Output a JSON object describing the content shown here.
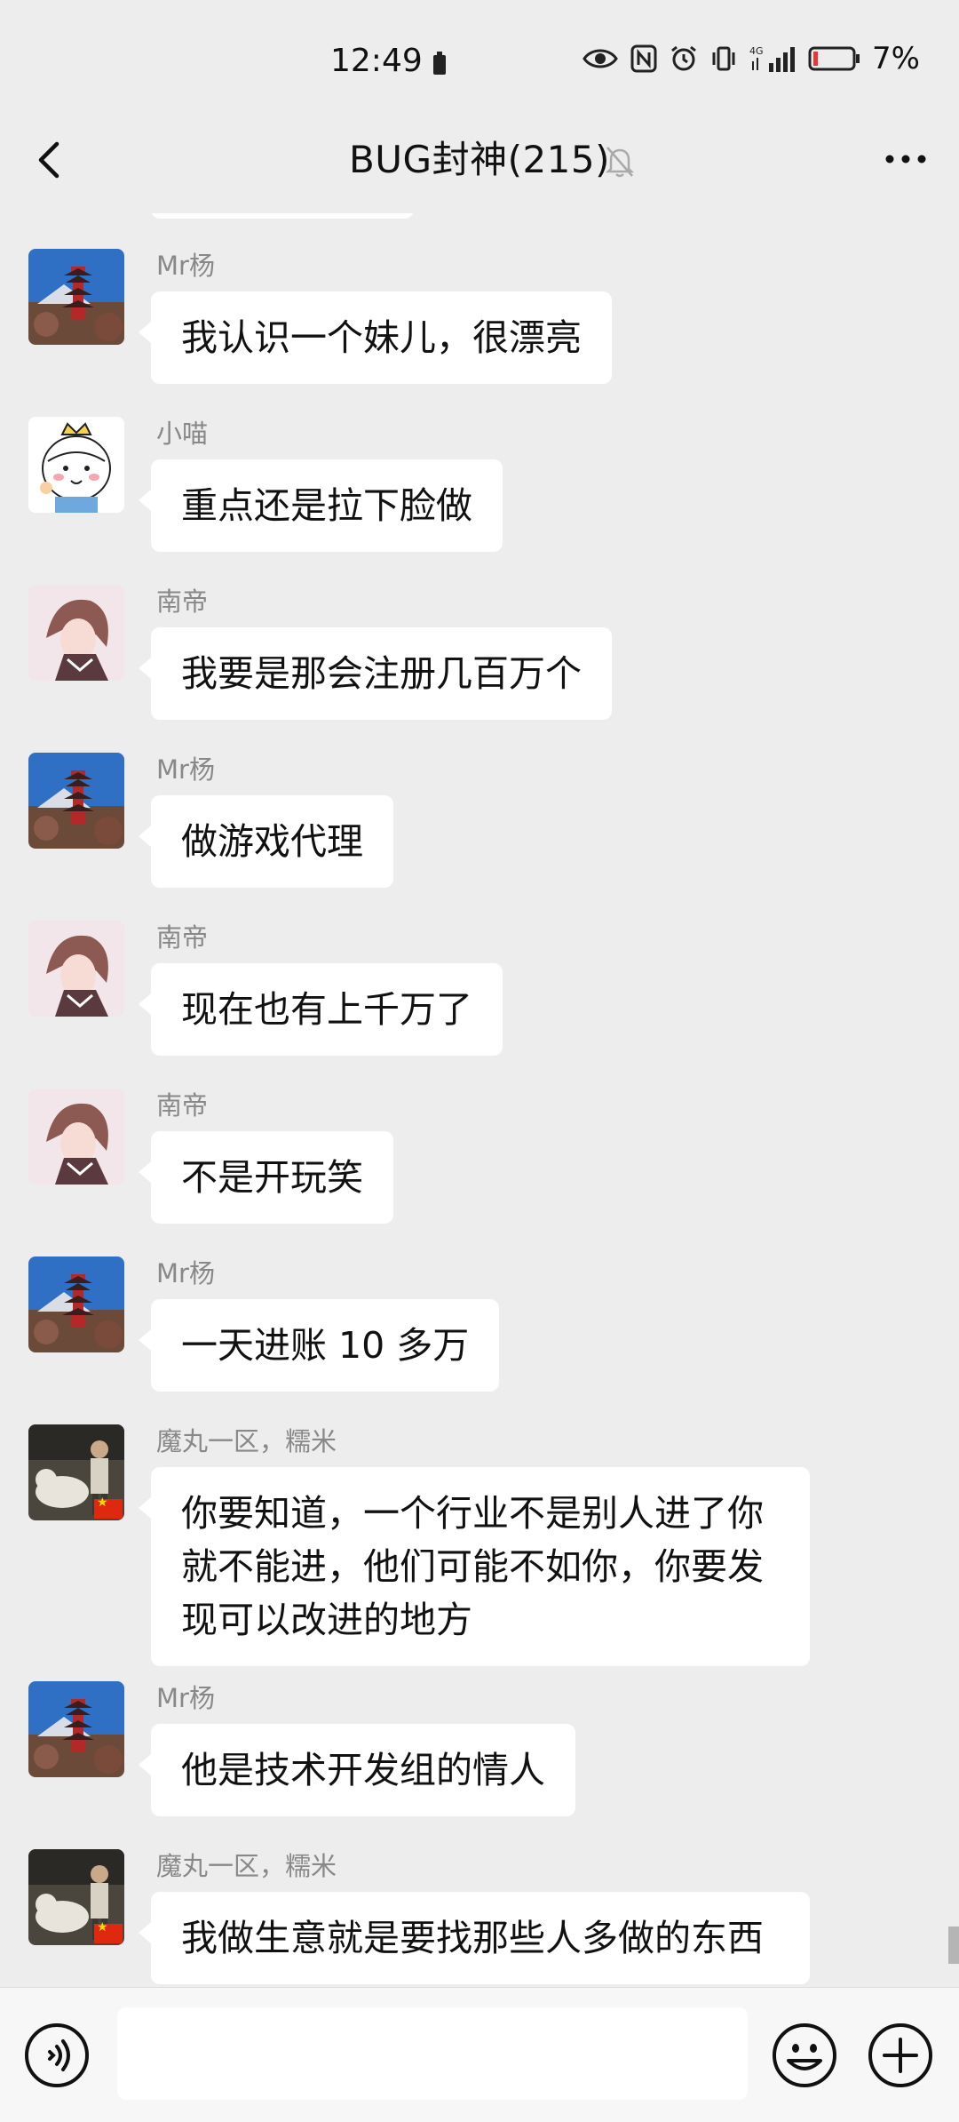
{
  "status_bar": {
    "time": "12:49",
    "battery_percent": "7%",
    "network": "4G"
  },
  "header": {
    "title": "BUG封神(215)"
  },
  "messages": [
    {
      "sender": "Mr杨",
      "text": "我认识一个妹儿，很漂亮",
      "avatar": "pagoda-avatar"
    },
    {
      "sender": "小喵",
      "text": "重点还是拉下脸做",
      "avatar": "cartoon-prince-avatar"
    },
    {
      "sender": "南帝",
      "text": "我要是那会注册几百万个",
      "avatar": "anime-boy-avatar"
    },
    {
      "sender": "Mr杨",
      "text": "做游戏代理",
      "avatar": "pagoda-avatar"
    },
    {
      "sender": "南帝",
      "text": "现在也有上千万了",
      "avatar": "anime-boy-avatar"
    },
    {
      "sender": "南帝",
      "text": "不是开玩笑",
      "avatar": "anime-boy-avatar"
    },
    {
      "sender": "Mr杨",
      "text": "一天进账 10 多万",
      "avatar": "pagoda-avatar"
    },
    {
      "sender": "魔丸一区，糯米",
      "text": "你要知道，一个行业不是别人进了你就不能进，他们可能不如你，你要发现可以改进的地方",
      "avatar": "man-with-dog-avatar"
    },
    {
      "sender": "Mr杨",
      "text": "他是技术开发组的情人",
      "avatar": "pagoda-avatar"
    },
    {
      "sender": "魔丸一区，糯米",
      "text": "我做生意就是要找那些人多做的东西",
      "avatar": "man-with-dog-avatar"
    }
  ],
  "input": {
    "value": "",
    "placeholder": ""
  }
}
